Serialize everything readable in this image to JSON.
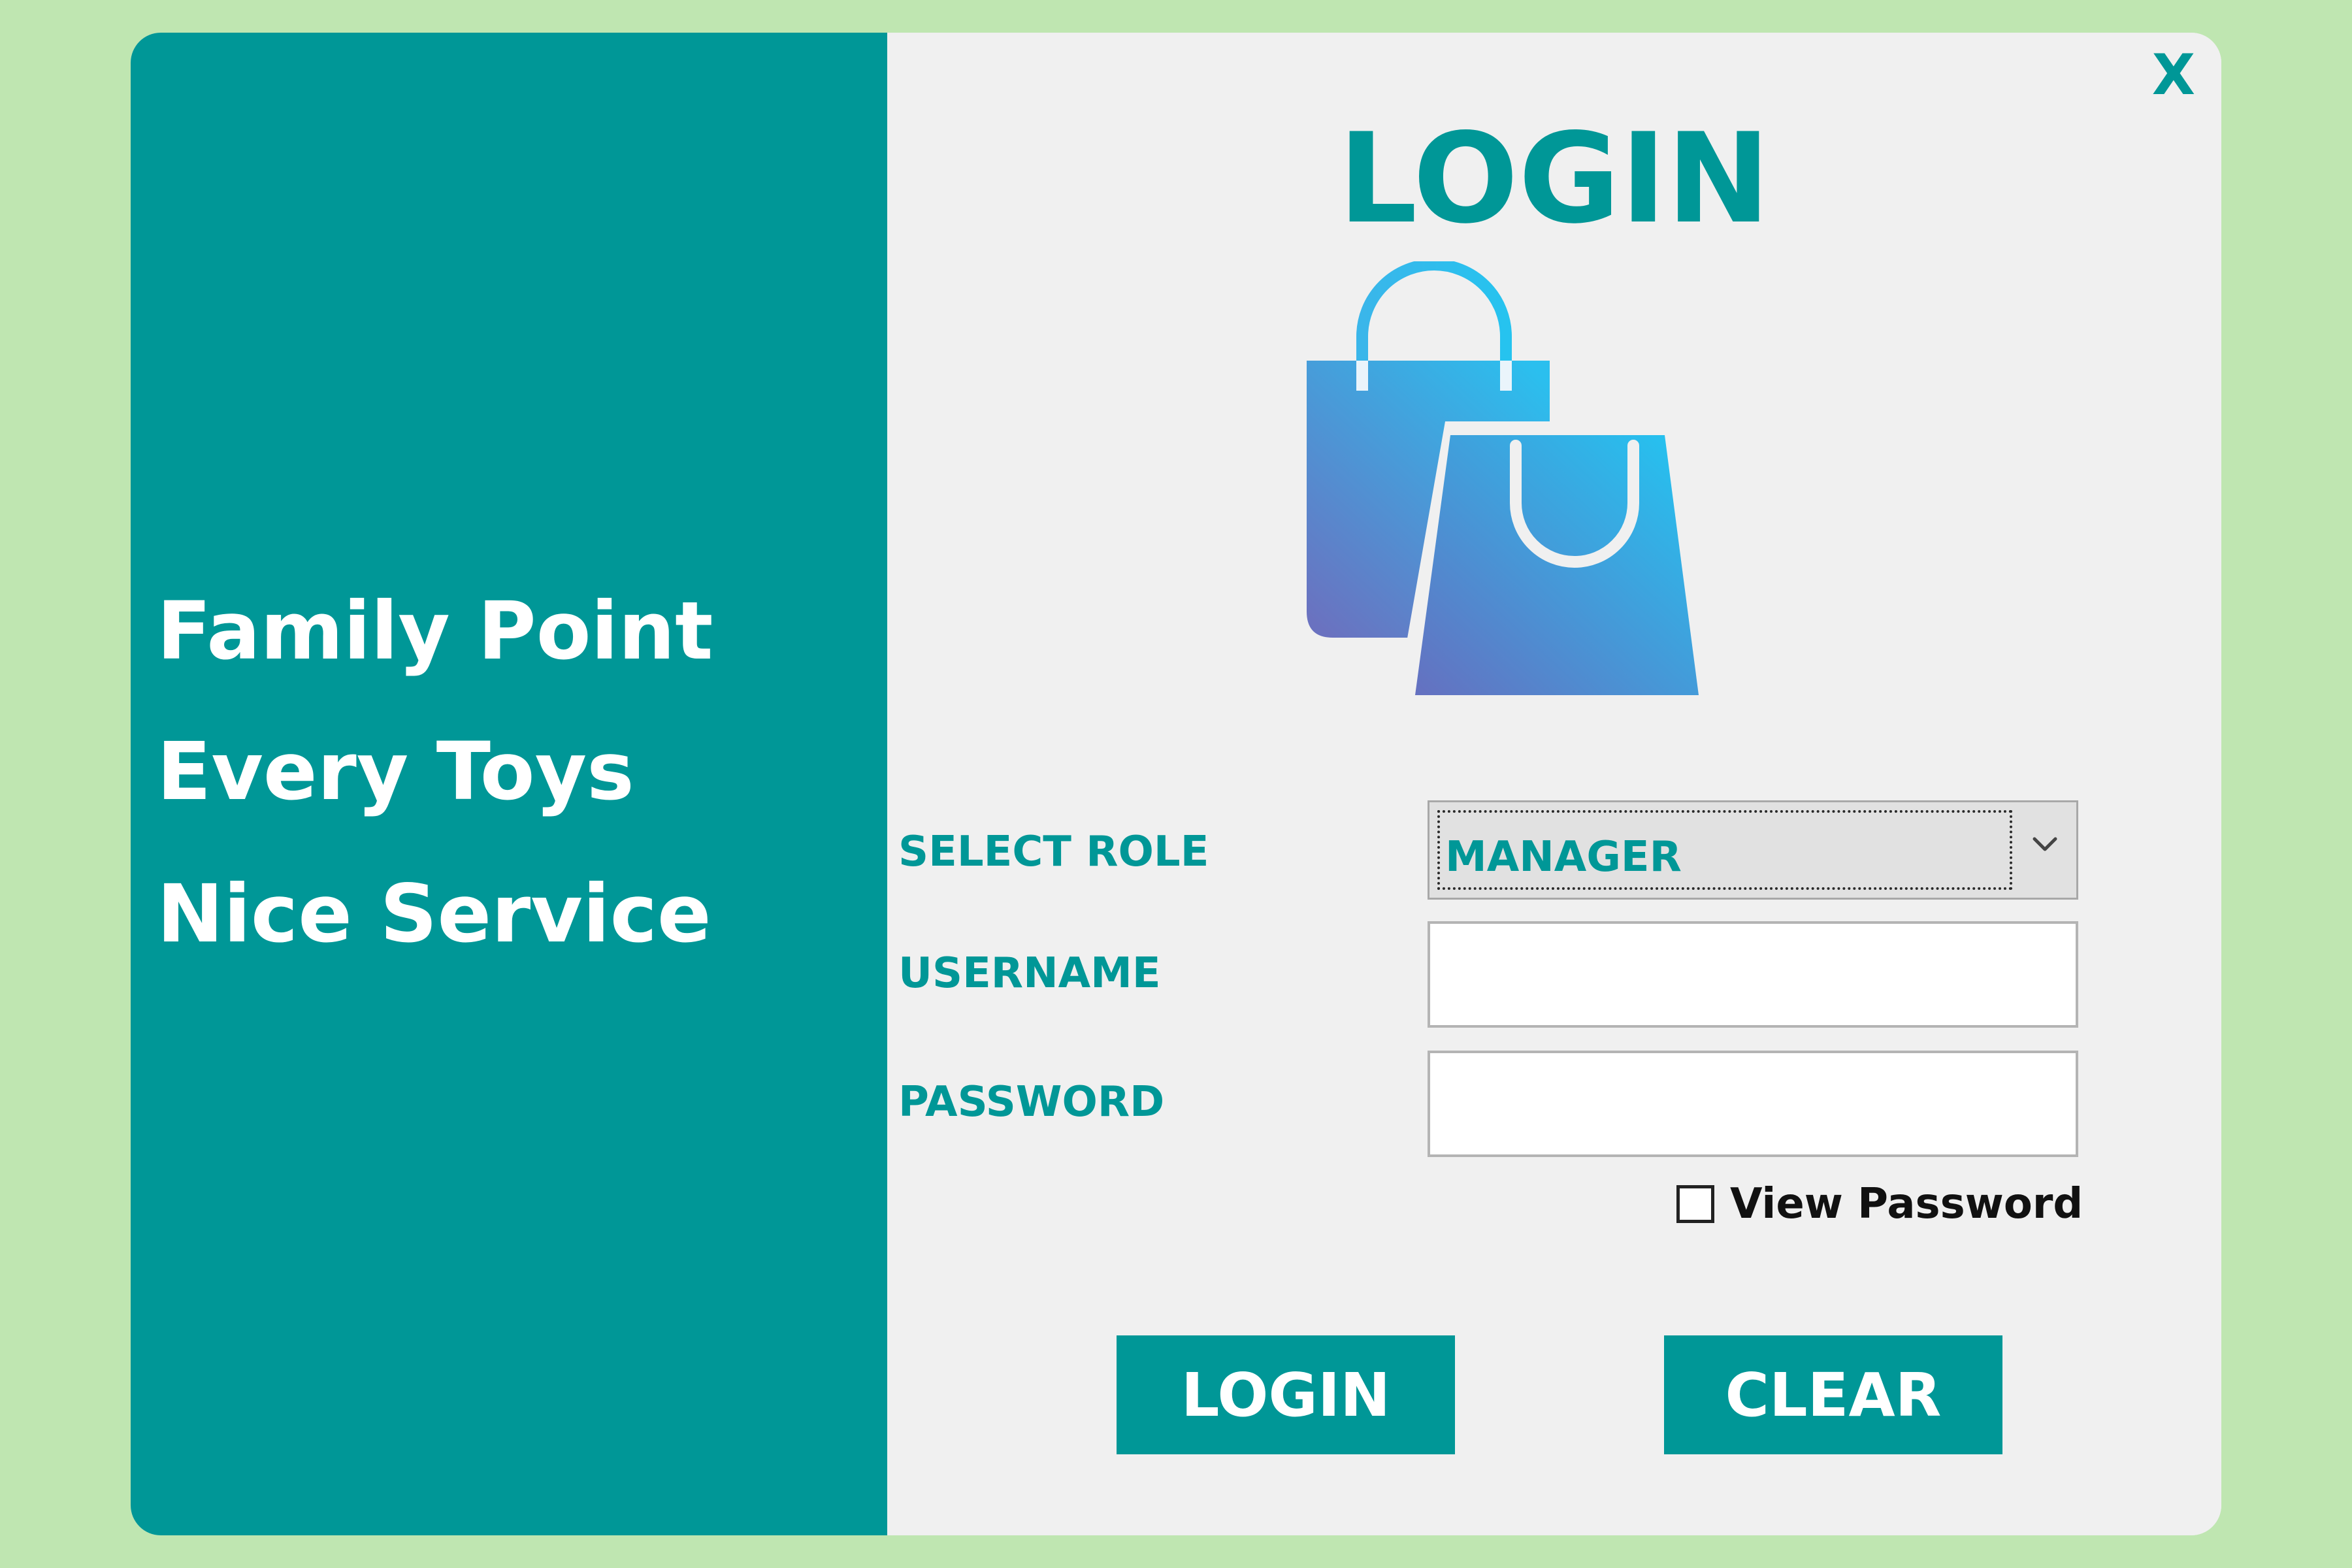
{
  "window": {
    "close_label": "X",
    "title": "LOGIN"
  },
  "brand": {
    "taglines": [
      "Family Point",
      "Every Toys",
      "Nice Service"
    ],
    "logo_icon": "shopping-bags-icon"
  },
  "form": {
    "role_label": "SELECT ROLE",
    "role_value": "MANAGER",
    "username_label": "USERNAME",
    "username_value": "",
    "password_label": "PASSWORD",
    "password_value": "",
    "view_password_label": "View Password",
    "view_password_checked": false
  },
  "actions": {
    "login_label": "LOGIN",
    "clear_label": "CLEAR"
  },
  "colors": {
    "background": "#bfe6b1",
    "accent": "#009797",
    "panel": "#f0f0f0",
    "bag_light": "#29c4f0",
    "bag_dark": "#6a6fbe"
  }
}
